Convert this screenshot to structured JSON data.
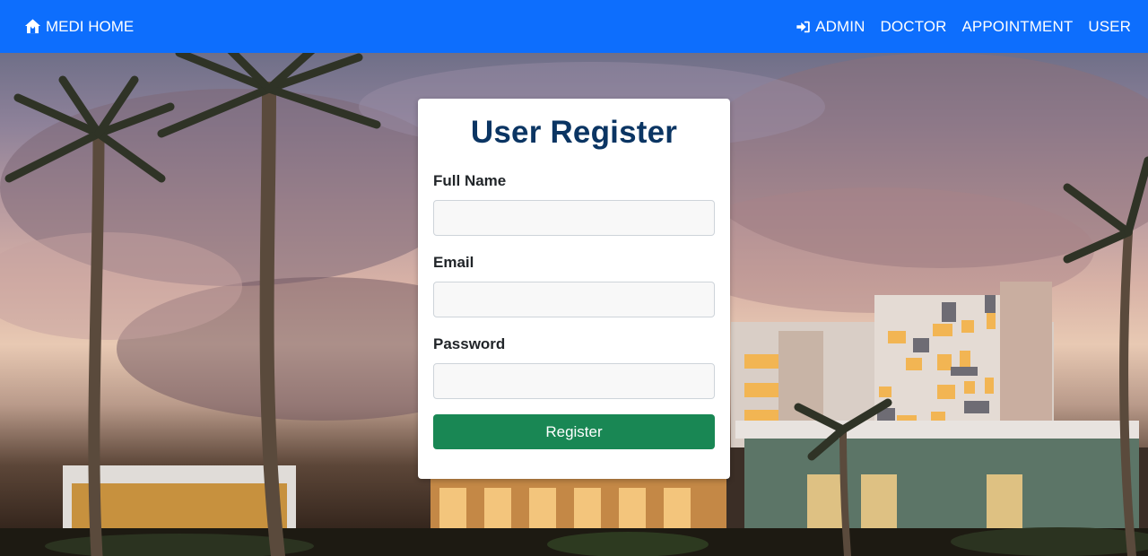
{
  "navbar": {
    "brand": {
      "icon": "home-icon",
      "label": "MEDI HOME"
    },
    "links": [
      {
        "label": "ADMIN",
        "icon": "sign-in-icon"
      },
      {
        "label": "DOCTOR"
      },
      {
        "label": "APPOINTMENT"
      },
      {
        "label": "USER"
      }
    ],
    "color": "#0d6efd"
  },
  "form": {
    "title": "User Register",
    "fields": [
      {
        "label": "Full Name",
        "value": "",
        "placeholder": ""
      },
      {
        "label": "Email",
        "value": "",
        "placeholder": ""
      },
      {
        "label": "Password",
        "value": "",
        "placeholder": ""
      }
    ],
    "submit_label": "Register",
    "title_color": "#0b3563",
    "button_color": "#198754"
  }
}
